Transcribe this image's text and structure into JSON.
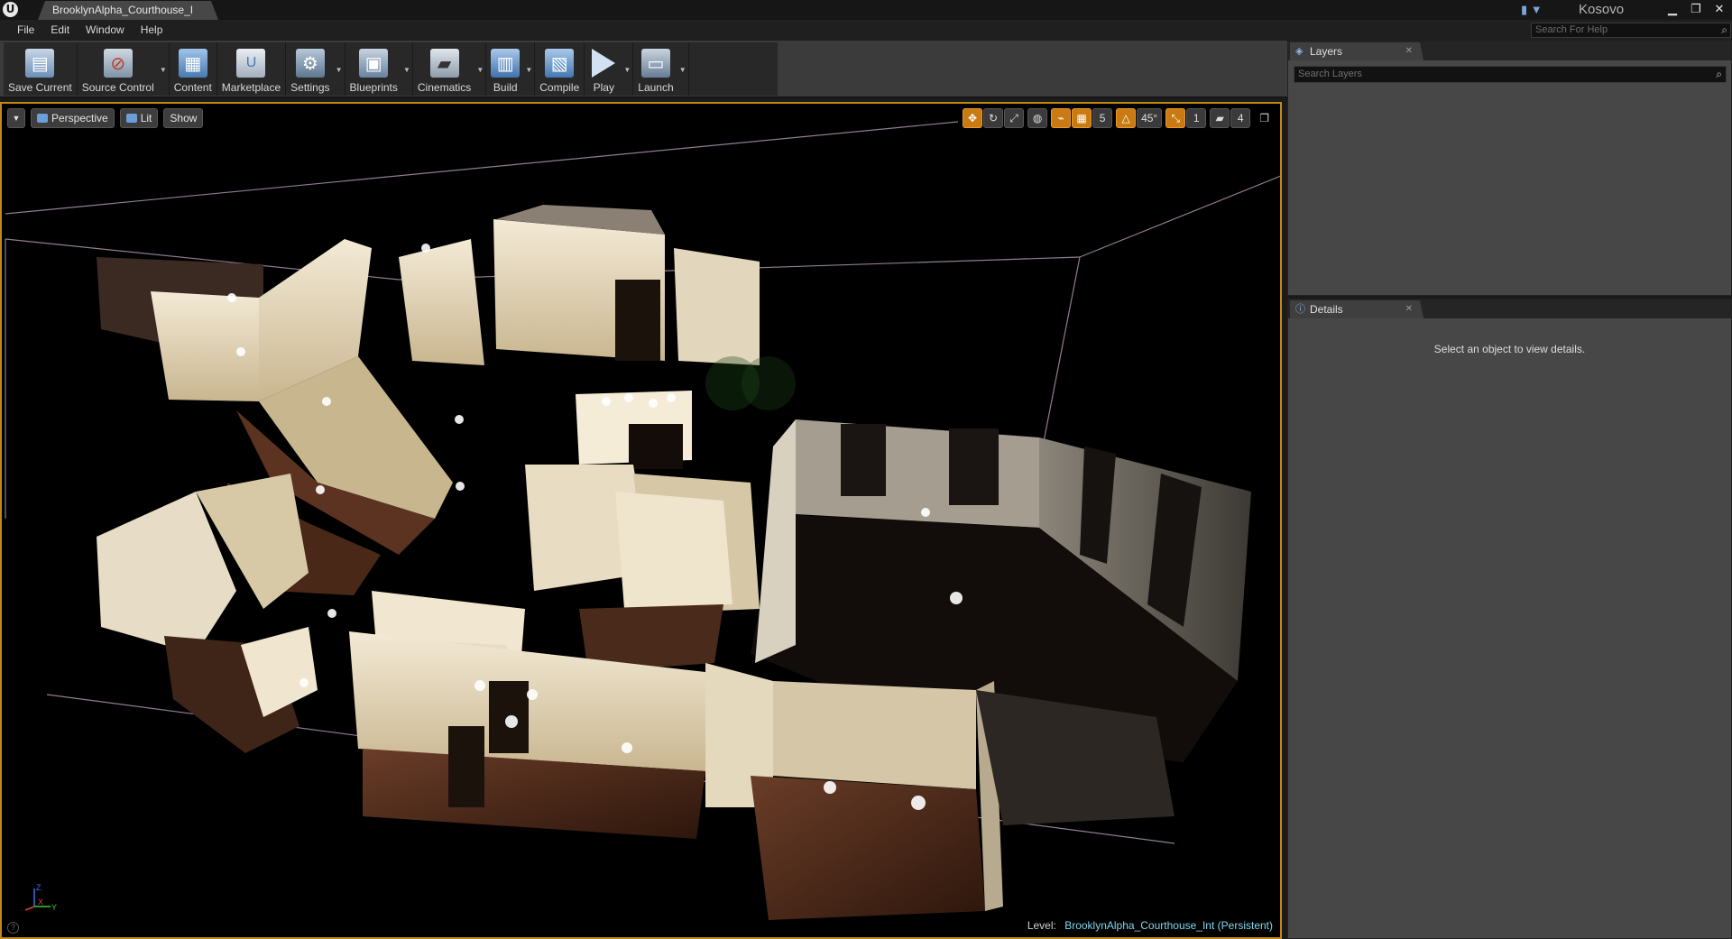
{
  "titlebar": {
    "doc_tab": "BrooklynAlpha_Courthouse_I",
    "project": "Kosovo",
    "controls": {
      "minimize": "▁",
      "restore": "❐",
      "close": "✕"
    }
  },
  "menu": {
    "items": [
      "File",
      "Edit",
      "Window",
      "Help"
    ],
    "help_search_placeholder": "Search For Help"
  },
  "toolbar": {
    "buttons": [
      {
        "label": "Save Current",
        "icon": "save-icon"
      },
      {
        "label": "Source Control",
        "icon": "source-control-icon"
      },
      {
        "label": "Content",
        "icon": "content-icon"
      },
      {
        "label": "Marketplace",
        "icon": "marketplace-icon"
      },
      {
        "label": "Settings",
        "icon": "settings-icon"
      },
      {
        "label": "Blueprints",
        "icon": "blueprints-icon"
      },
      {
        "label": "Cinematics",
        "icon": "cinematics-icon"
      },
      {
        "label": "Build",
        "icon": "build-icon"
      },
      {
        "label": "Compile",
        "icon": "compile-icon"
      },
      {
        "label": "Play",
        "icon": "play-icon"
      },
      {
        "label": "Launch",
        "icon": "launch-icon"
      }
    ]
  },
  "viewport": {
    "view_mode": "Perspective",
    "lighting": "Lit",
    "show": "Show",
    "grid_snap": "5",
    "rotation_snap": "45°",
    "scale_snap": "1",
    "camera_speed": "4",
    "level_prefix": "Level:",
    "level_name": "BrooklynAlpha_Courthouse_Int (Persistent)",
    "axis": {
      "x": "X",
      "y": "Y",
      "z": "Z"
    }
  },
  "layers_panel": {
    "tab": "Layers",
    "search_placeholder": "Search Layers"
  },
  "details_panel": {
    "tab": "Details",
    "empty_message": "Select an object to view details."
  },
  "colors": {
    "accent_orange": "#c97a12",
    "viewport_border": "#c18a14",
    "level_name": "#7fd6f0"
  }
}
